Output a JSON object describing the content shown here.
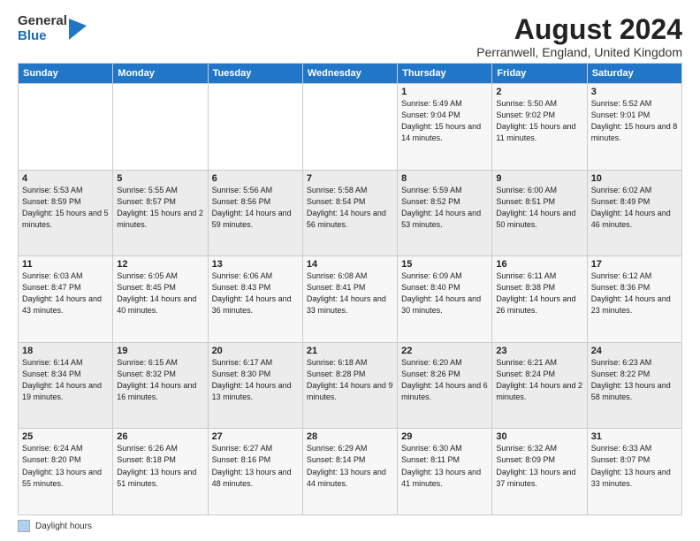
{
  "logo": {
    "general": "General",
    "blue": "Blue"
  },
  "title": {
    "month_year": "August 2024",
    "location": "Perranwell, England, United Kingdom"
  },
  "days_of_week": [
    "Sunday",
    "Monday",
    "Tuesday",
    "Wednesday",
    "Thursday",
    "Friday",
    "Saturday"
  ],
  "weeks": [
    [
      {
        "day": "",
        "info": ""
      },
      {
        "day": "",
        "info": ""
      },
      {
        "day": "",
        "info": ""
      },
      {
        "day": "",
        "info": ""
      },
      {
        "day": "1",
        "info": "Sunrise: 5:49 AM\nSunset: 9:04 PM\nDaylight: 15 hours and 14 minutes."
      },
      {
        "day": "2",
        "info": "Sunrise: 5:50 AM\nSunset: 9:02 PM\nDaylight: 15 hours and 11 minutes."
      },
      {
        "day": "3",
        "info": "Sunrise: 5:52 AM\nSunset: 9:01 PM\nDaylight: 15 hours and 8 minutes."
      }
    ],
    [
      {
        "day": "4",
        "info": "Sunrise: 5:53 AM\nSunset: 8:59 PM\nDaylight: 15 hours and 5 minutes."
      },
      {
        "day": "5",
        "info": "Sunrise: 5:55 AM\nSunset: 8:57 PM\nDaylight: 15 hours and 2 minutes."
      },
      {
        "day": "6",
        "info": "Sunrise: 5:56 AM\nSunset: 8:56 PM\nDaylight: 14 hours and 59 minutes."
      },
      {
        "day": "7",
        "info": "Sunrise: 5:58 AM\nSunset: 8:54 PM\nDaylight: 14 hours and 56 minutes."
      },
      {
        "day": "8",
        "info": "Sunrise: 5:59 AM\nSunset: 8:52 PM\nDaylight: 14 hours and 53 minutes."
      },
      {
        "day": "9",
        "info": "Sunrise: 6:00 AM\nSunset: 8:51 PM\nDaylight: 14 hours and 50 minutes."
      },
      {
        "day": "10",
        "info": "Sunrise: 6:02 AM\nSunset: 8:49 PM\nDaylight: 14 hours and 46 minutes."
      }
    ],
    [
      {
        "day": "11",
        "info": "Sunrise: 6:03 AM\nSunset: 8:47 PM\nDaylight: 14 hours and 43 minutes."
      },
      {
        "day": "12",
        "info": "Sunrise: 6:05 AM\nSunset: 8:45 PM\nDaylight: 14 hours and 40 minutes."
      },
      {
        "day": "13",
        "info": "Sunrise: 6:06 AM\nSunset: 8:43 PM\nDaylight: 14 hours and 36 minutes."
      },
      {
        "day": "14",
        "info": "Sunrise: 6:08 AM\nSunset: 8:41 PM\nDaylight: 14 hours and 33 minutes."
      },
      {
        "day": "15",
        "info": "Sunrise: 6:09 AM\nSunset: 8:40 PM\nDaylight: 14 hours and 30 minutes."
      },
      {
        "day": "16",
        "info": "Sunrise: 6:11 AM\nSunset: 8:38 PM\nDaylight: 14 hours and 26 minutes."
      },
      {
        "day": "17",
        "info": "Sunrise: 6:12 AM\nSunset: 8:36 PM\nDaylight: 14 hours and 23 minutes."
      }
    ],
    [
      {
        "day": "18",
        "info": "Sunrise: 6:14 AM\nSunset: 8:34 PM\nDaylight: 14 hours and 19 minutes."
      },
      {
        "day": "19",
        "info": "Sunrise: 6:15 AM\nSunset: 8:32 PM\nDaylight: 14 hours and 16 minutes."
      },
      {
        "day": "20",
        "info": "Sunrise: 6:17 AM\nSunset: 8:30 PM\nDaylight: 14 hours and 13 minutes."
      },
      {
        "day": "21",
        "info": "Sunrise: 6:18 AM\nSunset: 8:28 PM\nDaylight: 14 hours and 9 minutes."
      },
      {
        "day": "22",
        "info": "Sunrise: 6:20 AM\nSunset: 8:26 PM\nDaylight: 14 hours and 6 minutes."
      },
      {
        "day": "23",
        "info": "Sunrise: 6:21 AM\nSunset: 8:24 PM\nDaylight: 14 hours and 2 minutes."
      },
      {
        "day": "24",
        "info": "Sunrise: 6:23 AM\nSunset: 8:22 PM\nDaylight: 13 hours and 58 minutes."
      }
    ],
    [
      {
        "day": "25",
        "info": "Sunrise: 6:24 AM\nSunset: 8:20 PM\nDaylight: 13 hours and 55 minutes."
      },
      {
        "day": "26",
        "info": "Sunrise: 6:26 AM\nSunset: 8:18 PM\nDaylight: 13 hours and 51 minutes."
      },
      {
        "day": "27",
        "info": "Sunrise: 6:27 AM\nSunset: 8:16 PM\nDaylight: 13 hours and 48 minutes."
      },
      {
        "day": "28",
        "info": "Sunrise: 6:29 AM\nSunset: 8:14 PM\nDaylight: 13 hours and 44 minutes."
      },
      {
        "day": "29",
        "info": "Sunrise: 6:30 AM\nSunset: 8:11 PM\nDaylight: 13 hours and 41 minutes."
      },
      {
        "day": "30",
        "info": "Sunrise: 6:32 AM\nSunset: 8:09 PM\nDaylight: 13 hours and 37 minutes."
      },
      {
        "day": "31",
        "info": "Sunrise: 6:33 AM\nSunset: 8:07 PM\nDaylight: 13 hours and 33 minutes."
      }
    ]
  ],
  "footer": {
    "label": "Daylight hours"
  }
}
